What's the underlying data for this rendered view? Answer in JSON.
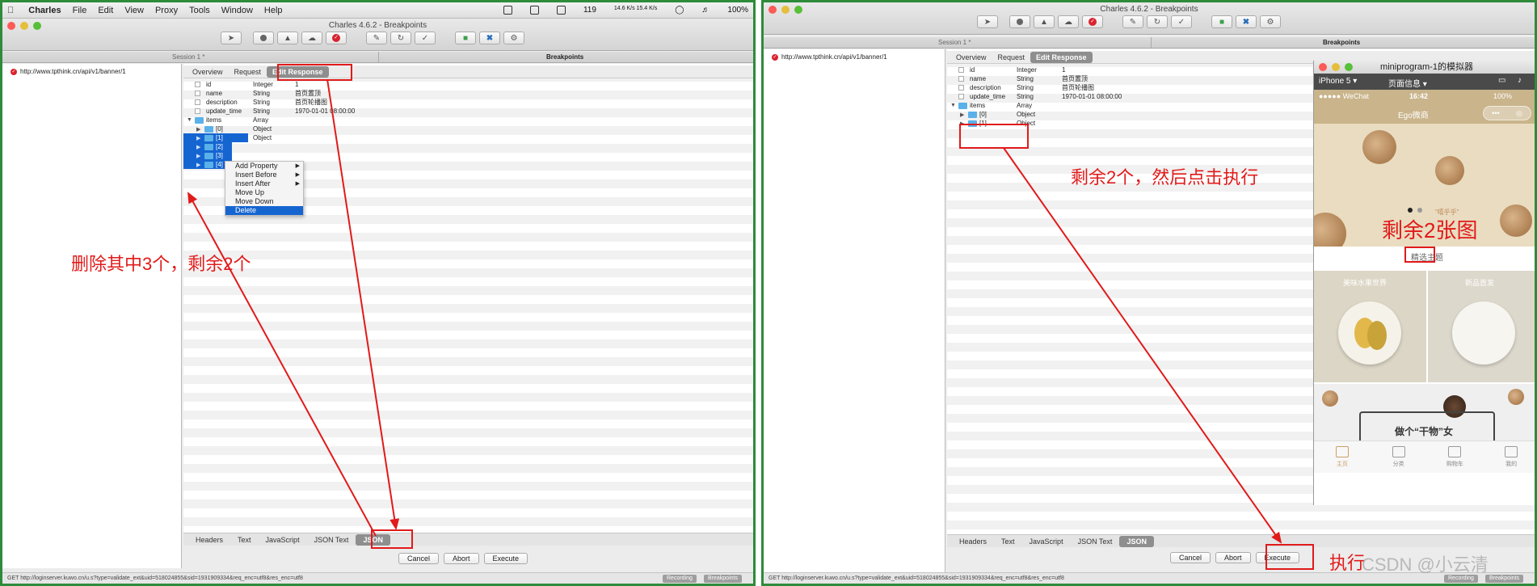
{
  "menubar": {
    "apple": "",
    "app": "Charles",
    "items": [
      "File",
      "Edit",
      "View",
      "Proxy",
      "Tools",
      "Window",
      "Help"
    ],
    "tray_count": "119",
    "net_speed": "14.6 K/s 15.4 K/s",
    "battery": "100%"
  },
  "window": {
    "title": "Charles 4.6.2 - Breakpoints",
    "session_tab": "Session 1 *",
    "breakpoints_tab": "Breakpoints"
  },
  "sidebar": {
    "url": "http://www.tpthink.cn/api/v1/banner/1"
  },
  "editor": {
    "tabs": [
      "Overview",
      "Request",
      "Edit Response"
    ],
    "active_tab": "Edit Response",
    "fields": [
      {
        "name": "id",
        "type": "Integer",
        "value": "1"
      },
      {
        "name": "name",
        "type": "String",
        "value": "首页置顶"
      },
      {
        "name": "description",
        "type": "String",
        "value": "首页轮播图"
      },
      {
        "name": "update_time",
        "type": "String",
        "value": "1970-01-01 08:00:00"
      },
      {
        "name": "items",
        "type": "Array",
        "value": ""
      }
    ],
    "left_items": [
      {
        "name": "[0]",
        "type": "Object"
      },
      {
        "name": "[1]",
        "type": "Object"
      },
      {
        "name": "[2]",
        "type": ""
      },
      {
        "name": "[3]",
        "type": ""
      },
      {
        "name": "[4]",
        "type": ""
      }
    ],
    "right_items": [
      {
        "name": "[0]",
        "type": "Object"
      },
      {
        "name": "[1]",
        "type": "Object"
      }
    ],
    "bottom_tabs": [
      "Headers",
      "Text",
      "JavaScript",
      "JSON Text",
      "JSON"
    ],
    "active_bottom_tab": "JSON"
  },
  "context_menu": {
    "items": [
      {
        "label": "Add Property",
        "submenu": true
      },
      {
        "label": "Insert Before",
        "submenu": true
      },
      {
        "label": "Insert After",
        "submenu": true
      },
      {
        "label": "Move Up",
        "submenu": false
      },
      {
        "label": "Move Down",
        "submenu": false
      },
      {
        "label": "Delete",
        "submenu": false
      }
    ],
    "highlighted": "Delete"
  },
  "buttons": {
    "cancel": "Cancel",
    "abort": "Abort",
    "execute": "Execute"
  },
  "status": {
    "url": "GET http://loginserver.kuwo.cn/u.s?type=validate_ext&uid=518024855&sid=1931909334&req_enc=utf8&res_enc=utf8",
    "recording": "Recording",
    "breakpoints": "Breakpoints"
  },
  "annotations": {
    "left_note": "删除其中3个，剩余2个",
    "right_note": "剩余2个，然后点击执行",
    "phone_note": "剩余2张图",
    "execute_note": "执行"
  },
  "simulator": {
    "title": "miniprogram-1的模拟器",
    "device": "iPhone 5",
    "page_info": "页面信息",
    "carrier": "●●●●● WeChat",
    "time": "16:42",
    "battery": "100%",
    "nav_title": "Ego微商",
    "capsule_more": "•••",
    "banner_caption": "“嘻乎乎”",
    "section_title": "精选主题",
    "theme1": "美味水果世界",
    "theme2": "新品首发",
    "promo_text": "做个“干物”女",
    "tabs": [
      {
        "label": "主页",
        "active": true
      },
      {
        "label": "分类",
        "active": false
      },
      {
        "label": "购物车",
        "active": false
      },
      {
        "label": "我的",
        "active": false
      }
    ]
  },
  "watermark": "CSDN @小云清"
}
